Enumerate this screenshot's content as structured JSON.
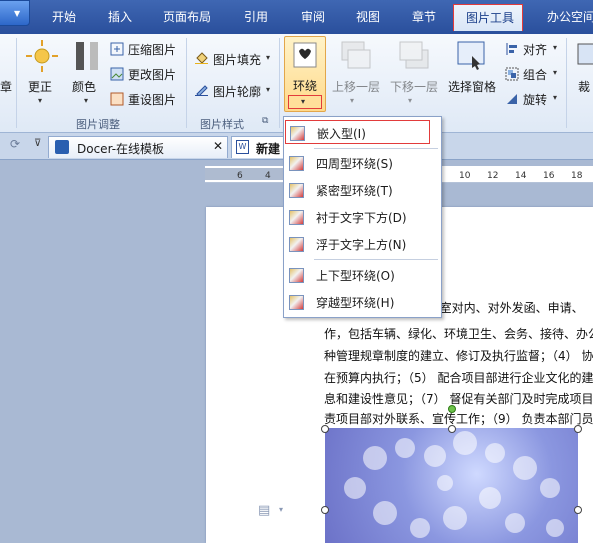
{
  "tabs": [
    "开始",
    "插入",
    "页面布局",
    "引用",
    "审阅",
    "视图",
    "章节",
    "图片工具",
    "办公空间"
  ],
  "ribbon": {
    "correct": "更正",
    "color": "颜色",
    "compress": "压缩图片",
    "change": "更改图片",
    "reset": "重设图片",
    "group_adjust": "图片调整",
    "fill": "图片填充",
    "outline": "图片轮廓",
    "group_style": "图片样式",
    "wrap": "环绕",
    "bring_forward": "上移一层",
    "send_backward": "下移一层",
    "selection_pane": "选择窗格",
    "align": "对齐",
    "group": "组合",
    "rotate": "旋转",
    "crop": "裁"
  },
  "doc_tabs": {
    "docer": "Docer-在线模板",
    "new": "新建"
  },
  "ruler_ticks": [
    "6",
    "4",
    "10",
    "12",
    "14",
    "16",
    "18"
  ],
  "wrap_menu": [
    "嵌入型(I)",
    "四周型环绕(S)",
    "紧密型环绕(T)",
    "衬于文字下方(D)",
    "浮于文字上方(N)",
    "上下型环绕(O)",
    "穿越型环绕(H)"
  ],
  "document_lines": [
    "（1）负责项目部办公室对内、对外发函、申请、",
    "作，包括车辆、绿化、环境卫生、会务、接待、办公",
    "种管理规章制度的建立、修订及执行监督；（4） 协助",
    "在预算内执行；（5） 配合项目部进行企业文化的建",
    "息和建设性意见；（7） 督促有关部门及时完成项目",
    "责项目部对外联系、宣传工作；（9） 负责本部门员"
  ],
  "colors": {
    "highlight_border": "#e23b3b",
    "tab_bar": "#2a4f9c"
  }
}
